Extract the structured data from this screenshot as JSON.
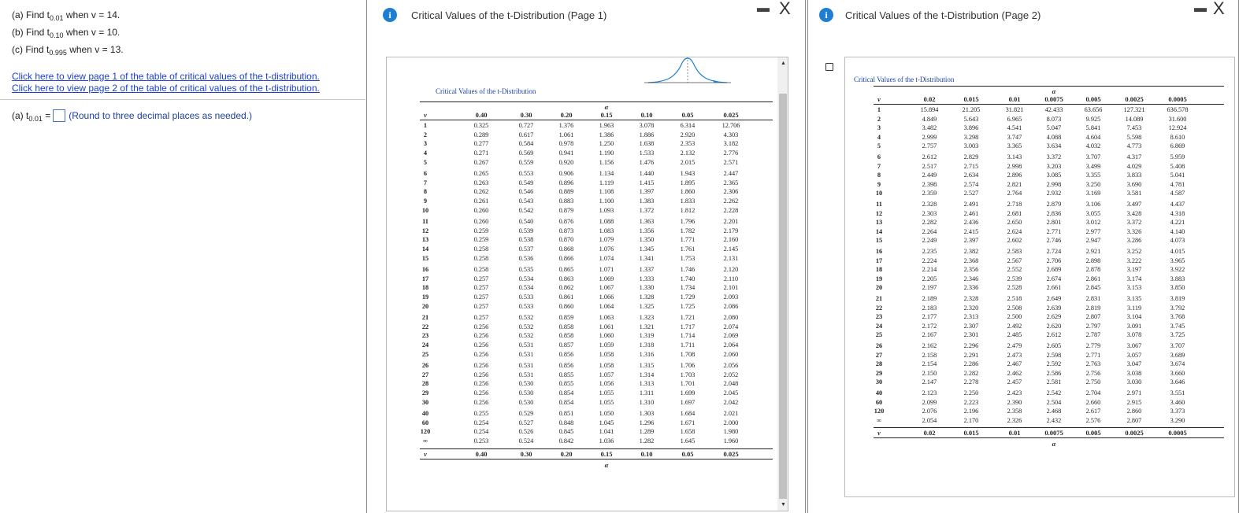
{
  "questions": {
    "a": {
      "pre": "(a) Find t",
      "sub": "0.01",
      "post": " when v = 14."
    },
    "b": {
      "pre": "(b) Find t",
      "sub": "0.10",
      "post": " when v = 10."
    },
    "c": {
      "pre": "(c) Find t",
      "sub": "0.995",
      "post": " when v = 13."
    }
  },
  "links": {
    "page1": "Click here to view page 1 of the table of critical values of the t-distribution.",
    "page2": "Click here to view page 2 of the table of critical values of the t-distribution."
  },
  "answer": {
    "pre": "(a) t",
    "sub": "0.01",
    "eq": " = ",
    "note": "(Round to three decimal places as needed.)"
  },
  "popup1": {
    "title": "Critical Values of the t-Distribution (Page 1)",
    "minimize": "▬",
    "close": "X"
  },
  "popup2": {
    "title": "Critical Values of the t-Distribution (Page 2)",
    "minimize": "▬",
    "close": "X"
  },
  "table1": {
    "caption": "Critical Values of the t-Distribution",
    "alpha_label": "α",
    "v_label": "v",
    "columns": [
      "0.40",
      "0.30",
      "0.20",
      "0.15",
      "0.10",
      "0.05",
      "0.025"
    ],
    "rows": [
      [
        "1",
        "0.325",
        "0.727",
        "1.376",
        "1.963",
        "3.078",
        "6.314",
        "12.706"
      ],
      [
        "2",
        "0.289",
        "0.617",
        "1.061",
        "1.386",
        "1.886",
        "2.920",
        "4.303"
      ],
      [
        "3",
        "0.277",
        "0.584",
        "0.978",
        "1.250",
        "1.638",
        "2.353",
        "3.182"
      ],
      [
        "4",
        "0.271",
        "0.569",
        "0.941",
        "1.190",
        "1.533",
        "2.132",
        "2.776"
      ],
      [
        "5",
        "0.267",
        "0.559",
        "0.920",
        "1.156",
        "1.476",
        "2.015",
        "2.571"
      ],
      [
        "6",
        "0.265",
        "0.553",
        "0.906",
        "1.134",
        "1.440",
        "1.943",
        "2.447"
      ],
      [
        "7",
        "0.263",
        "0.549",
        "0.896",
        "1.119",
        "1.415",
        "1.895",
        "2.365"
      ],
      [
        "8",
        "0.262",
        "0.546",
        "0.889",
        "1.108",
        "1.397",
        "1.860",
        "2.306"
      ],
      [
        "9",
        "0.261",
        "0.543",
        "0.883",
        "1.100",
        "1.383",
        "1.833",
        "2.262"
      ],
      [
        "10",
        "0.260",
        "0.542",
        "0.879",
        "1.093",
        "1.372",
        "1.812",
        "2.228"
      ],
      [
        "11",
        "0.260",
        "0.540",
        "0.876",
        "1.088",
        "1.363",
        "1.796",
        "2.201"
      ],
      [
        "12",
        "0.259",
        "0.539",
        "0.873",
        "1.083",
        "1.356",
        "1.782",
        "2.179"
      ],
      [
        "13",
        "0.259",
        "0.538",
        "0.870",
        "1.079",
        "1.350",
        "1.771",
        "2.160"
      ],
      [
        "14",
        "0.258",
        "0.537",
        "0.868",
        "1.076",
        "1.345",
        "1.761",
        "2.145"
      ],
      [
        "15",
        "0.258",
        "0.536",
        "0.866",
        "1.074",
        "1.341",
        "1.753",
        "2.131"
      ],
      [
        "16",
        "0.258",
        "0.535",
        "0.865",
        "1.071",
        "1.337",
        "1.746",
        "2.120"
      ],
      [
        "17",
        "0.257",
        "0.534",
        "0.863",
        "1.069",
        "1.333",
        "1.740",
        "2.110"
      ],
      [
        "18",
        "0.257",
        "0.534",
        "0.862",
        "1.067",
        "1.330",
        "1.734",
        "2.101"
      ],
      [
        "19",
        "0.257",
        "0.533",
        "0.861",
        "1.066",
        "1.328",
        "1.729",
        "2.093"
      ],
      [
        "20",
        "0.257",
        "0.533",
        "0.860",
        "1.064",
        "1.325",
        "1.725",
        "2.086"
      ],
      [
        "21",
        "0.257",
        "0.532",
        "0.859",
        "1.063",
        "1.323",
        "1.721",
        "2.080"
      ],
      [
        "22",
        "0.256",
        "0.532",
        "0.858",
        "1.061",
        "1.321",
        "1.717",
        "2.074"
      ],
      [
        "23",
        "0.256",
        "0.532",
        "0.858",
        "1.060",
        "1.319",
        "1.714",
        "2.069"
      ],
      [
        "24",
        "0.256",
        "0.531",
        "0.857",
        "1.059",
        "1.318",
        "1.711",
        "2.064"
      ],
      [
        "25",
        "0.256",
        "0.531",
        "0.856",
        "1.058",
        "1.316",
        "1.708",
        "2.060"
      ],
      [
        "26",
        "0.256",
        "0.531",
        "0.856",
        "1.058",
        "1.315",
        "1.706",
        "2.056"
      ],
      [
        "27",
        "0.256",
        "0.531",
        "0.855",
        "1.057",
        "1.314",
        "1.703",
        "2.052"
      ],
      [
        "28",
        "0.256",
        "0.530",
        "0.855",
        "1.056",
        "1.313",
        "1.701",
        "2.048"
      ],
      [
        "29",
        "0.256",
        "0.530",
        "0.854",
        "1.055",
        "1.311",
        "1.699",
        "2.045"
      ],
      [
        "30",
        "0.256",
        "0.530",
        "0.854",
        "1.055",
        "1.310",
        "1.697",
        "2.042"
      ],
      [
        "40",
        "0.255",
        "0.529",
        "0.851",
        "1.050",
        "1.303",
        "1.684",
        "2.021"
      ],
      [
        "60",
        "0.254",
        "0.527",
        "0.848",
        "1.045",
        "1.296",
        "1.671",
        "2.000"
      ],
      [
        "120",
        "0.254",
        "0.526",
        "0.845",
        "1.041",
        "1.289",
        "1.658",
        "1.980"
      ],
      [
        "∞",
        "0.253",
        "0.524",
        "0.842",
        "1.036",
        "1.282",
        "1.645",
        "1.960"
      ]
    ]
  },
  "table2": {
    "caption": "Critical Values of the t-Distribution",
    "alpha_label": "α",
    "v_label": "v",
    "columns": [
      "0.02",
      "0.015",
      "0.01",
      "0.0075",
      "0.005",
      "0.0025",
      "0.0005"
    ],
    "rows": [
      [
        "1",
        "15.894",
        "21.205",
        "31.821",
        "42.433",
        "63.656",
        "127.321",
        "636.578"
      ],
      [
        "2",
        "4.849",
        "5.643",
        "6.965",
        "8.073",
        "9.925",
        "14.089",
        "31.600"
      ],
      [
        "3",
        "3.482",
        "3.896",
        "4.541",
        "5.047",
        "5.841",
        "7.453",
        "12.924"
      ],
      [
        "4",
        "2.999",
        "3.298",
        "3.747",
        "4.088",
        "4.604",
        "5.598",
        "8.610"
      ],
      [
        "5",
        "2.757",
        "3.003",
        "3.365",
        "3.634",
        "4.032",
        "4.773",
        "6.869"
      ],
      [
        "6",
        "2.612",
        "2.829",
        "3.143",
        "3.372",
        "3.707",
        "4.317",
        "5.959"
      ],
      [
        "7",
        "2.517",
        "2.715",
        "2.998",
        "3.203",
        "3.499",
        "4.029",
        "5.408"
      ],
      [
        "8",
        "2.449",
        "2.634",
        "2.896",
        "3.085",
        "3.355",
        "3.833",
        "5.041"
      ],
      [
        "9",
        "2.398",
        "2.574",
        "2.821",
        "2.998",
        "3.250",
        "3.690",
        "4.781"
      ],
      [
        "10",
        "2.359",
        "2.527",
        "2.764",
        "2.932",
        "3.169",
        "3.581",
        "4.587"
      ],
      [
        "11",
        "2.328",
        "2.491",
        "2.718",
        "2.879",
        "3.106",
        "3.497",
        "4.437"
      ],
      [
        "12",
        "2.303",
        "2.461",
        "2.681",
        "2.836",
        "3.055",
        "3.428",
        "4.318"
      ],
      [
        "13",
        "2.282",
        "2.436",
        "2.650",
        "2.801",
        "3.012",
        "3.372",
        "4.221"
      ],
      [
        "14",
        "2.264",
        "2.415",
        "2.624",
        "2.771",
        "2.977",
        "3.326",
        "4.140"
      ],
      [
        "15",
        "2.249",
        "2.397",
        "2.602",
        "2.746",
        "2.947",
        "3.286",
        "4.073"
      ],
      [
        "16",
        "2.235",
        "2.382",
        "2.583",
        "2.724",
        "2.921",
        "3.252",
        "4.015"
      ],
      [
        "17",
        "2.224",
        "2.368",
        "2.567",
        "2.706",
        "2.898",
        "3.222",
        "3.965"
      ],
      [
        "18",
        "2.214",
        "2.356",
        "2.552",
        "2.689",
        "2.878",
        "3.197",
        "3.922"
      ],
      [
        "19",
        "2.205",
        "2.346",
        "2.539",
        "2.674",
        "2.861",
        "3.174",
        "3.883"
      ],
      [
        "20",
        "2.197",
        "2.336",
        "2.528",
        "2.661",
        "2.845",
        "3.153",
        "3.850"
      ],
      [
        "21",
        "2.189",
        "2.328",
        "2.518",
        "2.649",
        "2.831",
        "3.135",
        "3.819"
      ],
      [
        "22",
        "2.183",
        "2.320",
        "2.508",
        "2.639",
        "2.819",
        "3.119",
        "3.792"
      ],
      [
        "23",
        "2.177",
        "2.313",
        "2.500",
        "2.629",
        "2.807",
        "3.104",
        "3.768"
      ],
      [
        "24",
        "2.172",
        "2.307",
        "2.492",
        "2.620",
        "2.797",
        "3.091",
        "3.745"
      ],
      [
        "25",
        "2.167",
        "2.301",
        "2.485",
        "2.612",
        "2.787",
        "3.078",
        "3.725"
      ],
      [
        "26",
        "2.162",
        "2.296",
        "2.479",
        "2.605",
        "2.779",
        "3.067",
        "3.707"
      ],
      [
        "27",
        "2.158",
        "2.291",
        "2.473",
        "2.598",
        "2.771",
        "3.057",
        "3.689"
      ],
      [
        "28",
        "2.154",
        "2.286",
        "2.467",
        "2.592",
        "2.763",
        "3.047",
        "3.674"
      ],
      [
        "29",
        "2.150",
        "2.282",
        "2.462",
        "2.586",
        "2.756",
        "3.038",
        "3.660"
      ],
      [
        "30",
        "2.147",
        "2.278",
        "2.457",
        "2.581",
        "2.750",
        "3.030",
        "3.646"
      ],
      [
        "40",
        "2.123",
        "2.250",
        "2.423",
        "2.542",
        "2.704",
        "2.971",
        "3.551"
      ],
      [
        "60",
        "2.099",
        "2.223",
        "2.390",
        "2.504",
        "2.660",
        "2.915",
        "3.460"
      ],
      [
        "120",
        "2.076",
        "2.196",
        "2.358",
        "2.468",
        "2.617",
        "2.860",
        "3.373"
      ],
      [
        "∞",
        "2.054",
        "2.170",
        "2.326",
        "2.432",
        "2.576",
        "2.807",
        "3.290"
      ]
    ]
  }
}
